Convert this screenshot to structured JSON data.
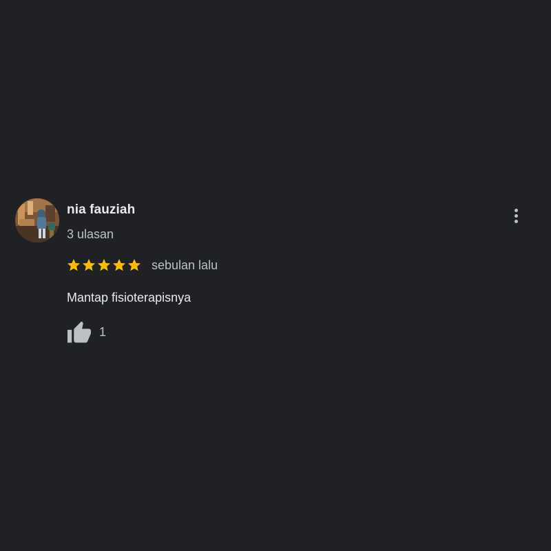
{
  "review": {
    "reviewer_name": "nia fauziah",
    "review_count": "3 ulasan",
    "rating": 5,
    "rating_max": 5,
    "time_ago": "sebulan lalu",
    "text": "Mantap fisioterapisnya",
    "like_count": "1"
  },
  "icons": {
    "more": "more-vert-icon",
    "like": "thumb-up-icon",
    "star": "star-icon"
  },
  "colors": {
    "background": "#202124",
    "star": "#fbbc04",
    "primary_text": "#e8eaed",
    "secondary_text": "#bdc1c6"
  }
}
